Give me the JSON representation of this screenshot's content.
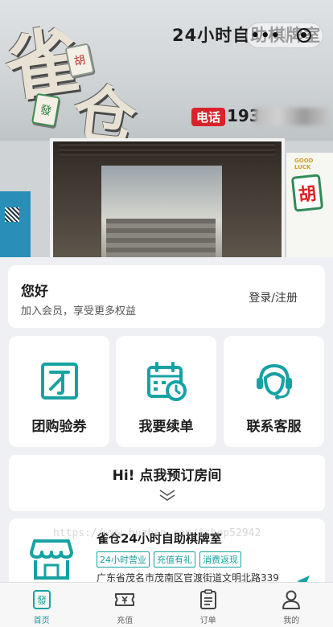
{
  "hero": {
    "char_1": "雀",
    "char_2": "仓",
    "tile_1": "胡",
    "tile_2": "發",
    "sign_text": "24小时自助棋牌室",
    "phone_tag": "电话",
    "phone_prefix": "193",
    "poster_tile": "胡",
    "poster_text": "GOOD LUCK"
  },
  "capsule": {
    "more_label": "•••"
  },
  "welcome": {
    "title": "您好",
    "subtitle": "加入会员，享受更多权益",
    "login_label": "登录/注册"
  },
  "actions": [
    {
      "label": "团购验券",
      "icon": "coupon-icon"
    },
    {
      "label": "我要续单",
      "icon": "calendar-renew-icon"
    },
    {
      "label": "联系客服",
      "icon": "customer-service-icon"
    }
  ],
  "booking": {
    "label": "Hi! 点我预订房间"
  },
  "store": {
    "name": "雀仓24小时自助棋牌室",
    "tags": [
      "24小时营业",
      "充值有礼",
      "消费返现"
    ],
    "address": "广东省茂名市茂南区官渡街道文明北路339",
    "icon": "store-icon"
  },
  "watermark": "https://www.huzhan.com/ishop52942",
  "tabbar": {
    "items": [
      {
        "label": "首页",
        "icon": "home-tile-icon",
        "active": true
      },
      {
        "label": "充值",
        "icon": "ticket-icon",
        "active": false
      },
      {
        "label": "订单",
        "icon": "order-list-icon",
        "active": false
      },
      {
        "label": "我的",
        "icon": "user-icon",
        "active": false
      }
    ]
  },
  "colors": {
    "accent": "#17a2a2",
    "card": "#ffffff",
    "background": "#eef0f3",
    "phone_tag": "#d8232a"
  }
}
